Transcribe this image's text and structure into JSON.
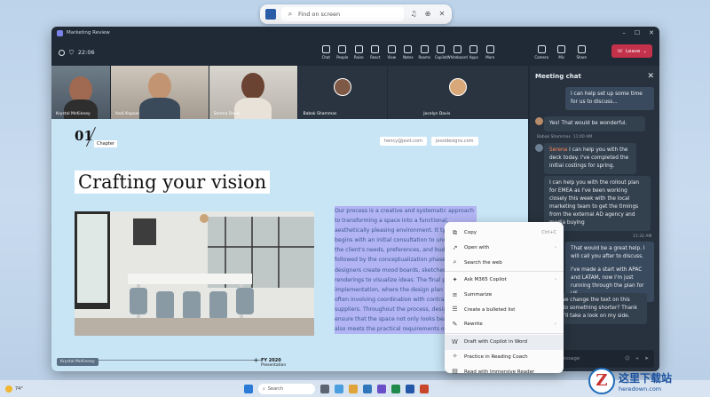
{
  "search": {
    "placeholder": "Find on screen"
  },
  "window": {
    "title": "Marketing Review",
    "timer": "22:06"
  },
  "toolbar": {
    "tools": [
      "Chat",
      "People",
      "Raise",
      "React",
      "View",
      "Notes",
      "Rooms",
      "Copilot",
      "Whiteboard",
      "Apps",
      "More"
    ],
    "media": [
      "Camera",
      "Mic",
      "Share"
    ],
    "people_count": "6",
    "leave": "Leave"
  },
  "participants": [
    {
      "name": "Krystal McKinney"
    },
    {
      "name": "Aadi Kapoor"
    },
    {
      "name": "Serena Davis"
    },
    {
      "name": "Babak Shammas"
    },
    {
      "name": "Jocelyn Davis"
    }
  ],
  "slide": {
    "chapter_num": "01",
    "chapter_label": "Chapter",
    "links": [
      "hency@jesit.com",
      "jessidesigns.com"
    ],
    "title": "Crafting your vision",
    "body_lines": [
      "Our process is a creative and systematic approach",
      "to transforming a space into a functional,",
      "aesthetically pleasing environment. It typically",
      "begins with an initial consultation to under",
      "the client's needs, preferences, and budg",
      "followed by the conceptualization phase,",
      "designers create mood boards, sketches,",
      "renderings to visualize ideas. The final ph",
      "implementation, where the design plan i",
      "often involving coordination with contra",
      "suppliers. Throughout the process, desig",
      "ensure that the space not only looks bea",
      "also meets the practical requirements of"
    ],
    "presenter": "Krystal McKinney",
    "fy_year": "FY 2020",
    "fy_sub": "Presentation"
  },
  "context_menu": [
    {
      "label": "Copy",
      "shortcut": "Ctrl+C",
      "icon": "copy-icon"
    },
    {
      "label": "Open with",
      "arrow": true,
      "icon": "open-with-icon"
    },
    {
      "label": "Search the web",
      "icon": "search-web-icon"
    },
    {
      "label": "Ask M365 Copilot",
      "arrow": true,
      "icon": "copilot-icon"
    },
    {
      "label": "Summarize",
      "icon": "summarize-icon"
    },
    {
      "label": "Create a bulleted list",
      "icon": "list-icon"
    },
    {
      "label": "Rewrite",
      "arrow": true,
      "icon": "rewrite-icon"
    },
    {
      "label": "Draft with Copilot in Word",
      "icon": "word-icon"
    },
    {
      "label": "Practice in Reading Coach",
      "icon": "reading-coach-icon"
    },
    {
      "label": "Read with Immersive Reader",
      "icon": "immersive-reader-icon"
    }
  ],
  "chat": {
    "title": "Meeting chat",
    "messages": [
      {
        "text": "I can help set up some time for us to discuss..."
      },
      {
        "text": "Yes! That would be wonderful."
      },
      {
        "sender": "Babak Shammas",
        "time": "11:00 AM"
      },
      {
        "mention": "Serena",
        "text": "I can help you with the deck today. I've completed the initial costings for spring."
      },
      {
        "text": "I can help you with the rollout plan for EMEA as I've been working closely this week with the local marketing team to get the timings from the external AD agency and media buying"
      },
      {
        "time": "11:32 AM"
      },
      {
        "text": "That would be a great help. I will call you after to discuss."
      },
      {
        "text": "I've made a start with APAC and LATAM, now I'm just running through the plan for US."
      },
      {
        "text": "Can we change the text on this slide to something shorter? Thank you! I'll take a look on my side."
      }
    ],
    "input_placeholder": "Type a message"
  },
  "taskbar": {
    "temp": "74°",
    "search": "Search"
  },
  "watermark": {
    "cn": "这里下载站",
    "en": "heredown.com"
  }
}
